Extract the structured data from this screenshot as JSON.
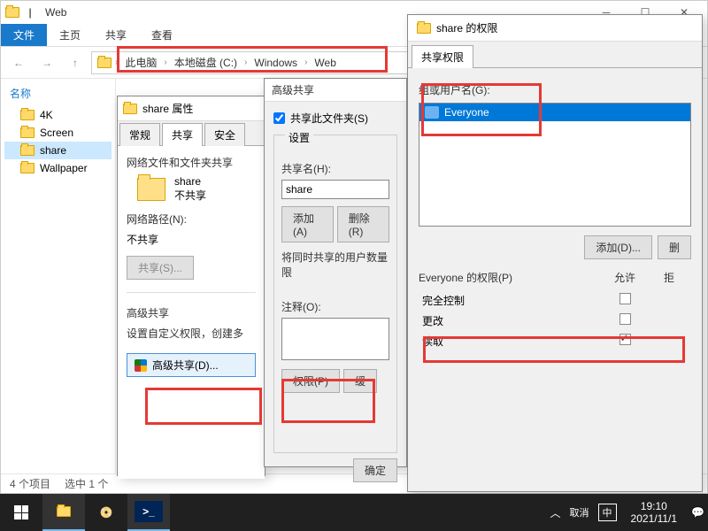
{
  "explorer": {
    "title": "Web",
    "ribbon": {
      "file": "文件",
      "home": "主页",
      "share": "共享",
      "view": "查看"
    },
    "breadcrumb": [
      "此电脑",
      "本地磁盘 (C:)",
      "Windows",
      "Web"
    ],
    "tree_header": "名称",
    "tree": [
      {
        "label": "4K"
      },
      {
        "label": "Screen"
      },
      {
        "label": "share",
        "selected": true
      },
      {
        "label": "Wallpaper"
      }
    ],
    "status": {
      "count": "4 个项目",
      "selected": "选中 1 个"
    }
  },
  "prop": {
    "title": "share 属性",
    "tabs": {
      "general": "常规",
      "sharing": "共享",
      "security": "安全"
    },
    "section1": "网络文件和文件夹共享",
    "folder_name": "share",
    "share_state": "不共享",
    "netpath_label": "网络路径(N):",
    "netpath_value": "不共享",
    "share_btn": "共享(S)...",
    "section2": "高级共享",
    "section2_desc": "设置自定义权限，创建多",
    "adv_btn": "高级共享(D)..."
  },
  "advanced": {
    "title": "高级共享",
    "share_folder": "共享此文件夹(S)",
    "settings": "设置",
    "share_name_label": "共享名(H):",
    "share_name_value": "share",
    "add_btn": "添加(A)",
    "remove_btn": "删除(R)",
    "concurrent": "将同时共享的用户数量限",
    "comment_label": "注释(O):",
    "perm_btn": "权限(P)",
    "cache_btn": "缓",
    "ok_btn": "确定"
  },
  "permissions": {
    "title": "share 的权限",
    "tab": "共享权限",
    "group_label": "组或用户名(G):",
    "users": [
      {
        "name": "Everyone",
        "selected": true
      }
    ],
    "add_btn": "添加(D)...",
    "remove_btn": "删",
    "perm_for": "Everyone 的权限(P)",
    "allow": "允许",
    "deny": "拒",
    "rows": [
      {
        "label": "完全控制",
        "allow": false
      },
      {
        "label": "更改",
        "allow": false
      },
      {
        "label": "读取",
        "allow": true
      }
    ]
  },
  "taskbar": {
    "time": "19:10",
    "date": "2021/11/1",
    "ime": "中",
    "tray_text": "取消"
  }
}
